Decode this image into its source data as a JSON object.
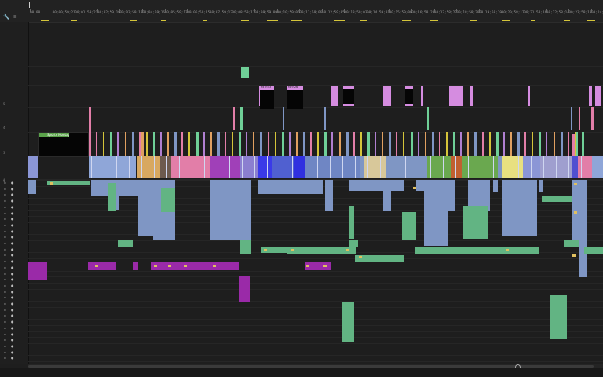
{
  "app": {
    "panel": "Timeline"
  },
  "header": {
    "wrench_icon": "wrench-icon",
    "timecodes": [
      "00;00",
      "00;00;59;21",
      "00;01;59;21",
      "00;02;59;19",
      "00;03;59;19",
      "00;04;59;16",
      "00;05;59;13",
      "00;06;59;15",
      "00;07;59;12",
      "00;08;59;11",
      "00;09;59;09",
      "00;10;59;06",
      "00;11;59;06",
      "00;12;59;05",
      "00;13;59;03",
      "00;14;59;01",
      "00;15;59;00",
      "00;16;58;23",
      "00;17;58;22",
      "00;18;58;20",
      "00;19;58;19",
      "00;20;58;17",
      "00;21;58;16",
      "00;22;58;14",
      "00;23;58;13",
      "00;24;58;12"
    ]
  },
  "tracks": {
    "video_labels": [
      "5",
      "4",
      "3",
      "2",
      "1"
    ],
    "audio_labels": [
      "A1",
      "A2",
      "A3",
      "A4",
      "A5",
      "A6",
      "A7",
      "A8",
      "A9",
      "A10",
      "A11",
      "A12",
      "A13",
      "A14",
      "A15",
      "A16",
      "A17",
      "A18",
      "A19",
      "A20",
      "A21",
      "A22",
      "A23",
      "A24",
      "A25",
      "A26",
      "A27",
      "A28",
      "A29",
      "A30"
    ]
  },
  "clips": {
    "nested_sequence_label": "Sports Montage",
    "title_clip_labels": [
      "fx  9:43",
      "fx  9:26"
    ]
  },
  "colors": {
    "audio_blue": "#7f96c4",
    "audio_green": "#62b483",
    "video_pink": "#e27ea8",
    "video_violet": "#8b7fd0",
    "title_magenta": "#d58ce0",
    "nest_green": "#5aa24a",
    "purple_track": "#9a2aa8",
    "marker_yellow": "#d4c43a"
  }
}
